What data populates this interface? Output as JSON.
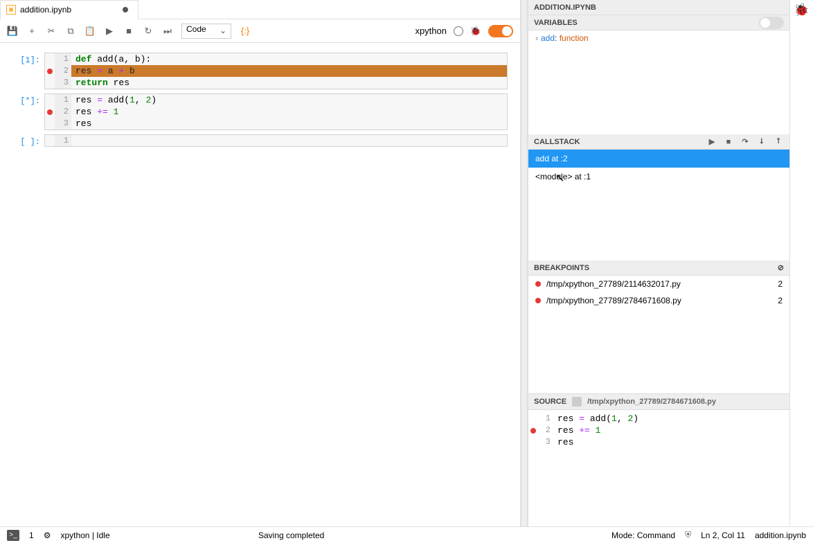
{
  "tab": {
    "title": "addition.ipynb",
    "dirty": true
  },
  "toolbar": {
    "celltype": "Code",
    "kernel": "xpython",
    "debug_on": true
  },
  "cells": [
    {
      "prompt": "[1]:",
      "selected": true,
      "lines": [
        {
          "n": "1",
          "bp": false,
          "hl": false,
          "html": "<span class='kw'>def</span> add(a, b):"
        },
        {
          "n": "2",
          "bp": true,
          "hl": true,
          "html": "    res <span class='op'>=</span> a <span class='op'>+</span> b"
        },
        {
          "n": "3",
          "bp": false,
          "hl": false,
          "html": "    <span class='kw'>return</span> res"
        }
      ]
    },
    {
      "prompt": "[*]:",
      "lines": [
        {
          "n": "1",
          "bp": false,
          "hl": false,
          "html": "res <span class='op'>=</span> add(<span class='num'>1</span>, <span class='num'>2</span>)"
        },
        {
          "n": "2",
          "bp": true,
          "hl": false,
          "html": "res <span class='op'>+=</span> <span class='num'>1</span>"
        },
        {
          "n": "3",
          "bp": false,
          "hl": false,
          "html": "res"
        }
      ]
    },
    {
      "prompt": "[ ]:",
      "empty": true,
      "lines": [
        {
          "n": "1",
          "bp": false,
          "hl": false,
          "html": ""
        }
      ]
    }
  ],
  "debugger": {
    "title": "ADDITION.IPYNB",
    "variables_label": "VARIABLES",
    "variables": [
      {
        "name": "add",
        "type": "function"
      }
    ],
    "callstack_label": "CALLSTACK",
    "callstack": [
      {
        "label": "add at :2",
        "selected": true
      },
      {
        "label": "<module> at :1",
        "selected": false
      }
    ],
    "breakpoints_label": "BREAKPOINTS",
    "breakpoints": [
      {
        "path": "/tmp/xpython_27789/2114632017.py",
        "line": "2"
      },
      {
        "path": "/tmp/xpython_27789/2784671608.py",
        "line": "2"
      }
    ],
    "source_label": "SOURCE",
    "source_path": "/tmp/xpython_27789/2784671608.py",
    "source_lines": [
      {
        "n": "1",
        "bp": false,
        "hl": false,
        "html": "res <span class='op'>=</span> add(<span class='num'>1</span>, <span class='num'>2</span>)"
      },
      {
        "n": "2",
        "bp": true,
        "hl": false,
        "html": "res <span class='op'>+=</span> <span class='num'>1</span>"
      },
      {
        "n": "3",
        "bp": false,
        "hl": false,
        "html": "res"
      }
    ]
  },
  "status": {
    "terminals": "1",
    "kernel": "xpython | Idle",
    "save": "Saving completed",
    "mode": "Mode: Command",
    "cursor": "Ln 2, Col 11",
    "file": "addition.ipynb"
  }
}
